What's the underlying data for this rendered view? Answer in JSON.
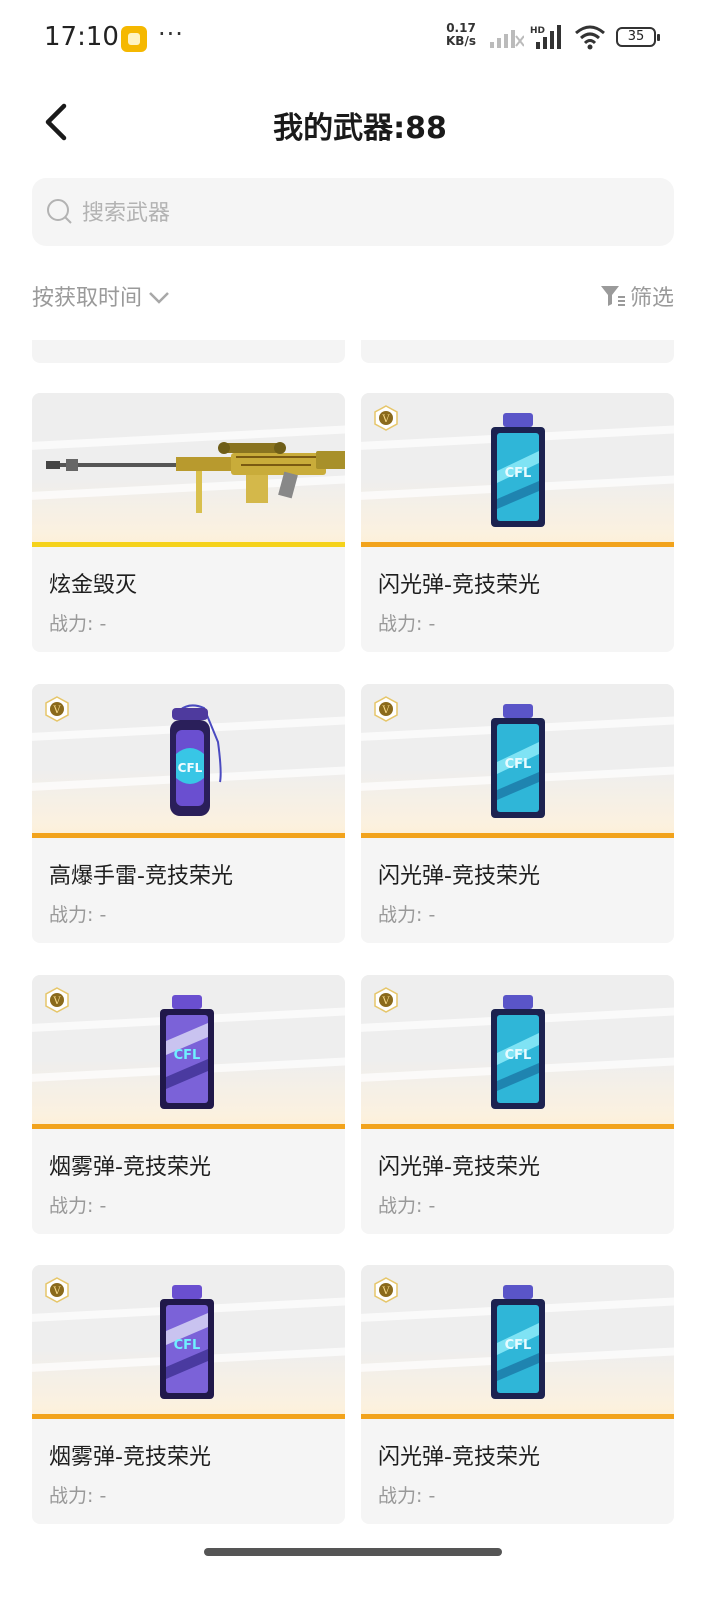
{
  "status_bar": {
    "time": "17:10",
    "speed_value": "0.17",
    "speed_unit": "KB/s",
    "hd_label": "HD",
    "battery": "35"
  },
  "header": {
    "title": "我的武器:88"
  },
  "search": {
    "placeholder": "搜索武器"
  },
  "toolbar": {
    "sort_label": "按获取时间",
    "filter_label": "筛选"
  },
  "weapons": [
    {
      "name": "炫金毁灭",
      "power": "战力: -",
      "type": "rifle",
      "badge": false
    },
    {
      "name": "闪光弹-竞技荣光",
      "power": "战力: -",
      "type": "flash",
      "badge": true
    },
    {
      "name": "高爆手雷-竞技荣光",
      "power": "战力: -",
      "type": "he",
      "badge": true
    },
    {
      "name": "闪光弹-竞技荣光",
      "power": "战力: -",
      "type": "flash",
      "badge": true
    },
    {
      "name": "烟雾弹-竞技荣光",
      "power": "战力: -",
      "type": "smoke",
      "badge": true
    },
    {
      "name": "闪光弹-竞技荣光",
      "power": "战力: -",
      "type": "flash",
      "badge": true
    },
    {
      "name": "烟雾弹-竞技荣光",
      "power": "战力: -",
      "type": "smoke",
      "badge": true
    },
    {
      "name": "闪光弹-竞技荣光",
      "power": "战力: -",
      "type": "flash",
      "badge": true
    }
  ],
  "colors": {
    "accent_bar": "#f2a31c",
    "gold_bar": "#f5d21b",
    "card_bg": "#f5f5f5"
  }
}
